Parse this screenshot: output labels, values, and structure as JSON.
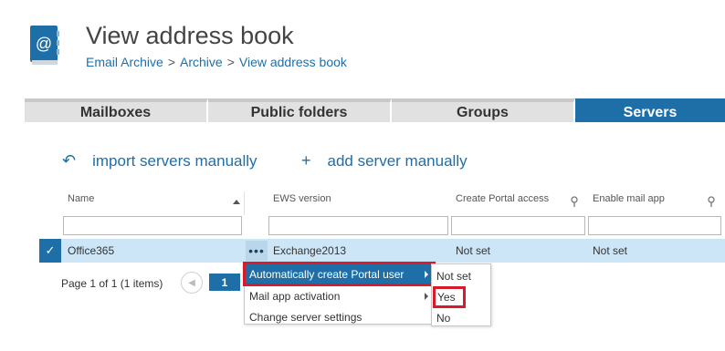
{
  "header": {
    "title": "View address book",
    "breadcrumb": [
      "Email Archive",
      "Archive",
      "View address book"
    ],
    "breadcrumb_separator": ">",
    "icon": "address-book-icon",
    "accent_color": "#1e6fa8"
  },
  "tabs": [
    {
      "label": "Mailboxes",
      "active": false
    },
    {
      "label": "Public folders",
      "active": false
    },
    {
      "label": "Groups",
      "active": false
    },
    {
      "label": "Servers",
      "active": true
    }
  ],
  "actions": {
    "import_label": "import servers manually",
    "import_icon": "undo-arrow-icon",
    "add_label": "add server manually",
    "add_icon": "plus-icon"
  },
  "grid": {
    "columns": [
      "Name",
      "EWS version",
      "Create Portal access",
      "Enable mail app"
    ],
    "sort_column": "Name",
    "rows": [
      {
        "selected": true,
        "name": "Office365",
        "more": "•••",
        "ews_version": "Exchange2013",
        "create_portal_access": "Not set",
        "enable_mail_app": "Not set"
      }
    ]
  },
  "pager": {
    "text": "Page 1 of 1 (1 items)",
    "current_page": "1"
  },
  "context_menu": {
    "items": [
      {
        "label": "Automatically create Portal user",
        "has_submenu": true,
        "highlighted": true
      },
      {
        "label": "Mail app activation",
        "has_submenu": true,
        "highlighted": false
      },
      {
        "label": "Change server settings",
        "has_submenu": false,
        "highlighted": false
      }
    ],
    "submenu": [
      "Not set",
      "Yes",
      "No"
    ],
    "submenu_highlighted": "Yes",
    "highlight_color": "#d81b2a"
  }
}
